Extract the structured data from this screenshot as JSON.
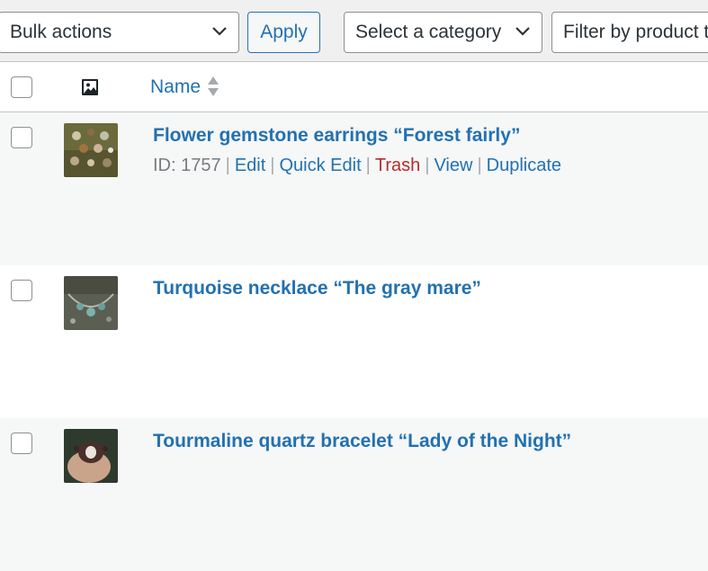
{
  "toolbar": {
    "bulk_actions": "Bulk actions",
    "apply": "Apply",
    "category": "Select a category",
    "product_filter": "Filter by product t"
  },
  "table": {
    "name_header": "Name"
  },
  "rows": [
    {
      "title": "Flower gemstone earrings “Forest fairly”",
      "id_label": "ID: 1757",
      "edit": "Edit",
      "quick_edit": "Quick Edit",
      "trash": "Trash",
      "view": "View",
      "duplicate": "Duplicate"
    },
    {
      "title": "Turquoise necklace “The gray mare”"
    },
    {
      "title": "Tourmaline quartz bracelet “Lady of the Night”"
    }
  ],
  "colors": {
    "link": "#2271b1",
    "trash": "#b32d2e",
    "muted": "#787c82",
    "row_alt": "#f6f7f7"
  },
  "icons": {
    "image_column": "image-icon",
    "sort": "sort-arrows-icon",
    "dropdown": "chevron-down-icon"
  }
}
